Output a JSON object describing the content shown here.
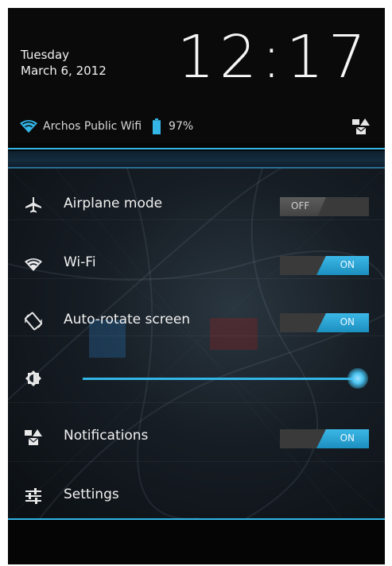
{
  "header": {
    "day": "Tuesday",
    "date": "March 6, 2012",
    "time": "12:17",
    "network_name": "Archos Public Wifi",
    "battery_percent": "97%",
    "battery_level": 0.97
  },
  "quick_settings": {
    "airplane": {
      "label": "Airplane mode",
      "state": "OFF"
    },
    "wifi": {
      "label": "Wi-Fi",
      "state": "ON"
    },
    "autorotate": {
      "label": "Auto-rotate screen",
      "state": "ON"
    },
    "brightness": {
      "level": 1.0
    },
    "notifications": {
      "label": "Notifications",
      "state": "ON"
    },
    "settings": {
      "label": "Settings"
    }
  },
  "colors": {
    "accent": "#33b5e5",
    "background": "#070707"
  },
  "icons": {
    "airplane": "airplane-icon",
    "wifi": "wifi-icon",
    "autorotate": "rotate-icon",
    "brightness": "brightness-icon",
    "notifications": "notifications-icon",
    "settings": "settings-sliders-icon",
    "battery": "battery-icon"
  }
}
